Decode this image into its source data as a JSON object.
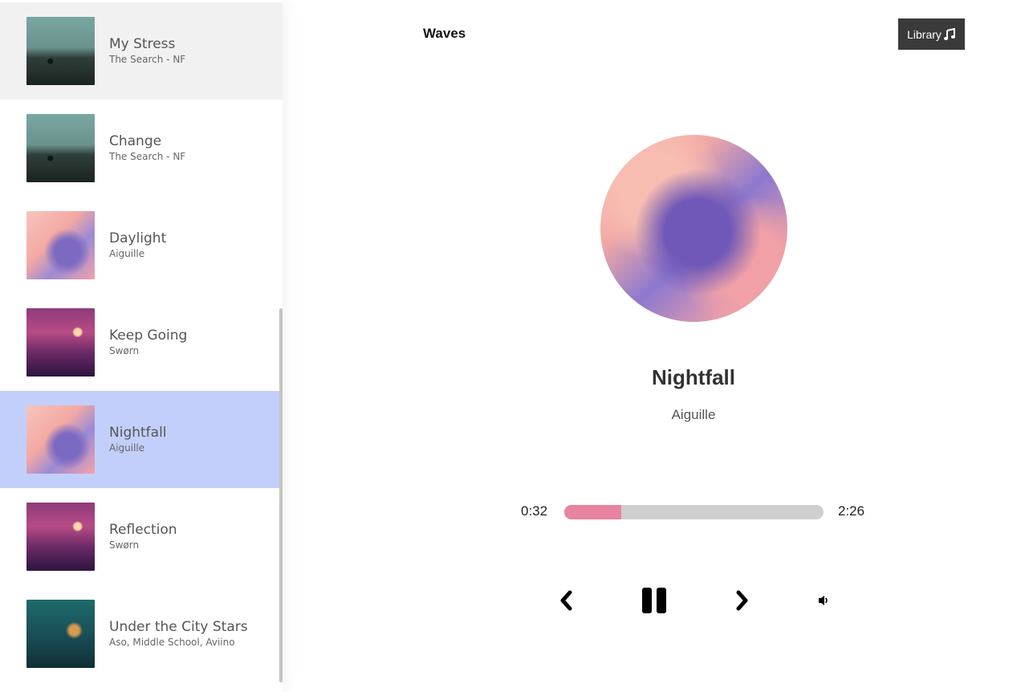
{
  "app": {
    "brand": "Waves"
  },
  "header": {
    "library_label": "Library"
  },
  "library": {
    "songs": [
      {
        "name": "My Stress",
        "artist": "The Search - NF",
        "cover": "the-search-cover"
      },
      {
        "name": "Change",
        "artist": "The Search - NF",
        "cover": "the-search-cover"
      },
      {
        "name": "Daylight",
        "artist": "Aiguille",
        "cover": "aiguille-cover"
      },
      {
        "name": "Keep Going",
        "artist": "Swørn",
        "cover": "sworn-cover"
      },
      {
        "name": "Nightfall",
        "artist": "Aiguille",
        "cover": "aiguille-cover"
      },
      {
        "name": "Reflection",
        "artist": "Swørn",
        "cover": "sworn-cover"
      },
      {
        "name": "Under the City Stars",
        "artist": "Aso, Middle School, Aviino",
        "cover": "canary-forest-cover"
      }
    ],
    "selected_index": 4,
    "hovered_index": 0
  },
  "player": {
    "title": "Nightfall",
    "artist": "Aiguille",
    "current_time": "0:32",
    "total_time": "2:26",
    "progress_fraction": 0.22,
    "controls": [
      "chevron-left-icon",
      "pause-icon",
      "chevron-right-icon",
      "volume-icon"
    ]
  },
  "colors": {
    "selected_row": "#c3cffb",
    "progress_fill": "#e8849f",
    "progress_track": "#cfcfcf",
    "library_button": "#3a3a3a"
  }
}
